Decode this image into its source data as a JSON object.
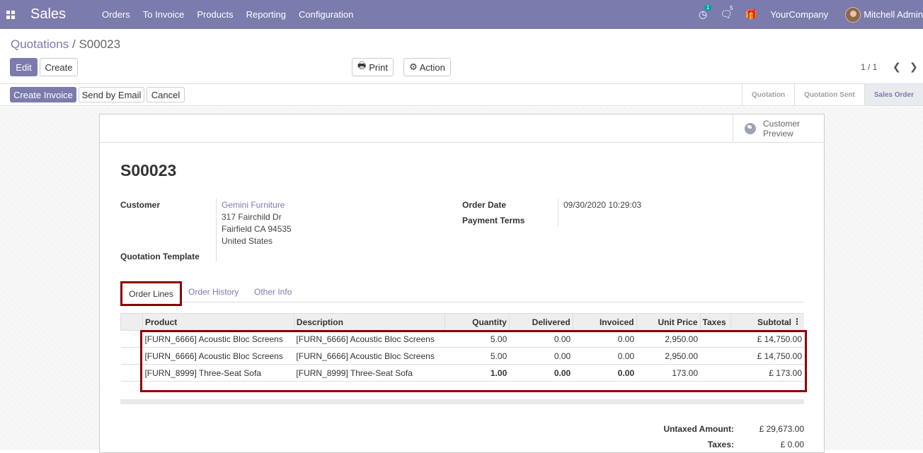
{
  "navbar": {
    "app_title": "Sales",
    "menu": [
      "Orders",
      "To Invoice",
      "Products",
      "Reporting",
      "Configuration"
    ],
    "activity_count": "1",
    "messages_count": "5",
    "company": "YourCompany",
    "user": "Mitchell Admin"
  },
  "breadcrumb": {
    "parent": "Quotations",
    "separator": "/",
    "current": "S00023"
  },
  "control": {
    "edit": "Edit",
    "create": "Create",
    "print": "Print",
    "action": "Action",
    "pager": "1 / 1"
  },
  "header_buttons": {
    "create_invoice": "Create Invoice",
    "send_by_email": "Send by Email",
    "cancel": "Cancel"
  },
  "status_steps": [
    "Quotation",
    "Quotation Sent",
    "Sales Order"
  ],
  "status_active": "Sales Order",
  "smart_button": {
    "line1": "Customer",
    "line2": "Preview"
  },
  "order": {
    "name": "S00023",
    "customer_label": "Customer",
    "customer_name": "Gemini Furniture",
    "address": [
      "317 Fairchild Dr",
      "Fairfield CA 94535",
      "United States"
    ],
    "quotation_template_label": "Quotation Template",
    "order_date_label": "Order Date",
    "order_date": "09/30/2020 10:29:03",
    "payment_terms_label": "Payment Terms"
  },
  "tabs": [
    "Order Lines",
    "Order History",
    "Other Info"
  ],
  "lines_table": {
    "columns": [
      "Product",
      "Description",
      "Quantity",
      "Delivered",
      "Invoiced",
      "Unit Price",
      "Taxes",
      "Subtotal"
    ],
    "rows": [
      {
        "product": "[FURN_6666] Acoustic Bloc Screens",
        "description": "[FURN_6666] Acoustic Bloc Screens",
        "quantity": "5.00",
        "delivered": "0.00",
        "invoiced": "0.00",
        "unit_price": "2,950.00",
        "taxes": "",
        "subtotal": "£ 14,750.00"
      },
      {
        "product": "[FURN_6666] Acoustic Bloc Screens",
        "description": "[FURN_6666] Acoustic Bloc Screens",
        "quantity": "5.00",
        "delivered": "0.00",
        "invoiced": "0.00",
        "unit_price": "2,950.00",
        "taxes": "",
        "subtotal": "£ 14,750.00"
      },
      {
        "product": "[FURN_8999] Three-Seat Sofa",
        "description": "[FURN_8999] Three-Seat Sofa",
        "quantity": "1.00",
        "delivered": "0.00",
        "invoiced": "0.00",
        "unit_price": "173.00",
        "taxes": "",
        "subtotal": "£ 173.00"
      }
    ]
  },
  "totals": {
    "untaxed_label": "Untaxed Amount:",
    "untaxed_value": "£ 29,673.00",
    "taxes_label": "Taxes:",
    "taxes_value": "£ 0.00"
  },
  "colors": {
    "brand": "#7c7bad",
    "highlight": "#8b0000",
    "teal": "#00a09d"
  }
}
